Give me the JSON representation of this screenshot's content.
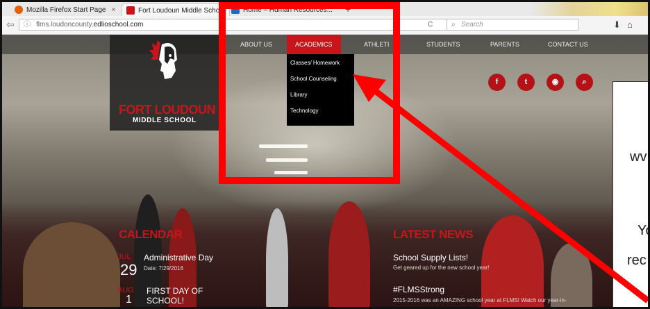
{
  "browser": {
    "tabs": [
      {
        "label": "Mozilla Firefox Start Page",
        "close": "×",
        "icon_color": "#e66000"
      },
      {
        "label": "Fort Loudoun Middle School",
        "close": "×",
        "icon_color": "#c8151b"
      },
      {
        "label": "Home – Human Resources...",
        "close": "×",
        "icon_color": "#1e6bc4"
      }
    ],
    "new_tab": "+",
    "url_host": "flms.loudoncounty.",
    "url_domain": "edlioschool.com",
    "search_placeholder": "Search"
  },
  "site": {
    "school_name": "FORT LOUDOUN",
    "school_sub": "MIDDLE SCHOOL",
    "menu": [
      {
        "label": "ABOUT US"
      },
      {
        "label": "ACADEMICS",
        "active": true
      },
      {
        "label": "ATHLETI"
      },
      {
        "label": "STUDENTS"
      },
      {
        "label": "PARENTS"
      },
      {
        "label": "CONTACT US"
      }
    ],
    "dropdown": [
      "Classes/ Homework",
      "School Counseling",
      "Library",
      "Technology"
    ],
    "social": [
      {
        "icon": "facebook-icon",
        "glyph": "f"
      },
      {
        "icon": "twitter-icon",
        "glyph": "t"
      },
      {
        "icon": "rss-icon",
        "glyph": "◉"
      },
      {
        "icon": "search-icon",
        "glyph": "⌕"
      }
    ],
    "calendar": {
      "heading": "CALENDAR",
      "events": [
        {
          "month": "JUL",
          "day": "29",
          "title": "Administrative Day",
          "sub": "Date: 7/29/2016"
        },
        {
          "month": "AUG",
          "day": "1",
          "title": "FIRST DAY OF",
          "title2": "SCHOOL!"
        }
      ]
    },
    "news": {
      "heading": "LATEST NEWS",
      "items": [
        {
          "title": "School Supply Lists!",
          "sub": "Get geared up for the new school year!"
        },
        {
          "title": "#FLMSStrong",
          "sub": "2015-2016 was an AMAZING school year at FLMS! Watch our year-in-"
        }
      ]
    }
  },
  "note": {
    "lines": [
      "wv",
      "Yo",
      "rec"
    ]
  },
  "colors": {
    "brand_red": "#c8151b",
    "highlight_red": "#ff0000"
  }
}
